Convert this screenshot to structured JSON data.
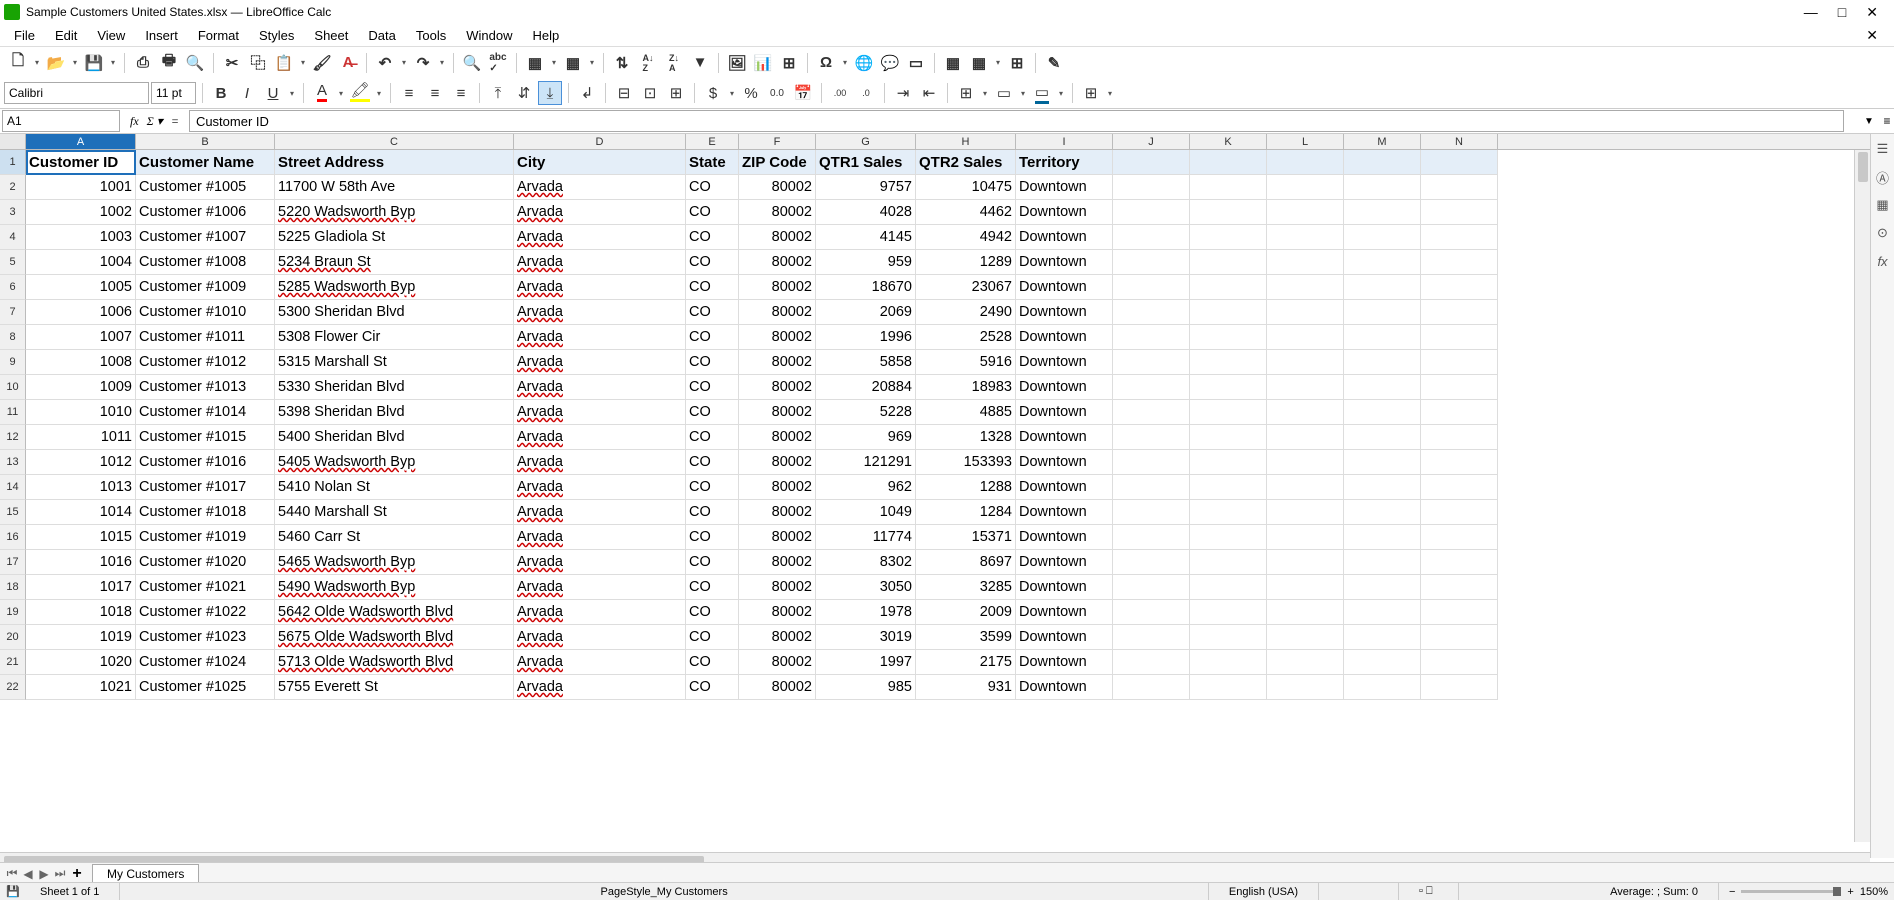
{
  "window": {
    "title": "Sample Customers United States.xlsx — LibreOffice Calc"
  },
  "menu": [
    "File",
    "Edit",
    "View",
    "Insert",
    "Format",
    "Styles",
    "Sheet",
    "Data",
    "Tools",
    "Window",
    "Help"
  ],
  "format": {
    "font_name": "Calibri",
    "font_size": "11 pt"
  },
  "formula": {
    "cell_ref": "A1",
    "content": "Customer ID"
  },
  "columns": [
    "A",
    "B",
    "C",
    "D",
    "E",
    "F",
    "G",
    "H",
    "I",
    "J",
    "K",
    "L",
    "M",
    "N"
  ],
  "headers": [
    "Customer ID",
    "Customer Name",
    "Street Address",
    "City",
    "State",
    "ZIP Code",
    "QTR1 Sales",
    "QTR2 Sales",
    "Territory"
  ],
  "rows": [
    {
      "id": 1001,
      "name": "Customer #1005",
      "street": "11700 W 58th Ave",
      "city": "Arvada",
      "state": "CO",
      "zip": 80002,
      "q1": 9757,
      "q2": 10475,
      "terr": "Downtown"
    },
    {
      "id": 1002,
      "name": "Customer #1006",
      "street": "5220 Wadsworth Byp",
      "city": "Arvada",
      "state": "CO",
      "zip": 80002,
      "q1": 4028,
      "q2": 4462,
      "terr": "Downtown"
    },
    {
      "id": 1003,
      "name": "Customer #1007",
      "street": "5225 Gladiola St",
      "city": "Arvada",
      "state": "CO",
      "zip": 80002,
      "q1": 4145,
      "q2": 4942,
      "terr": "Downtown"
    },
    {
      "id": 1004,
      "name": "Customer #1008",
      "street": "5234 Braun St",
      "city": "Arvada",
      "state": "CO",
      "zip": 80002,
      "q1": 959,
      "q2": 1289,
      "terr": "Downtown"
    },
    {
      "id": 1005,
      "name": "Customer #1009",
      "street": "5285 Wadsworth Byp",
      "city": "Arvada",
      "state": "CO",
      "zip": 80002,
      "q1": 18670,
      "q2": 23067,
      "terr": "Downtown"
    },
    {
      "id": 1006,
      "name": "Customer #1010",
      "street": "5300 Sheridan Blvd",
      "city": "Arvada",
      "state": "CO",
      "zip": 80002,
      "q1": 2069,
      "q2": 2490,
      "terr": "Downtown"
    },
    {
      "id": 1007,
      "name": "Customer #1011",
      "street": "5308 Flower Cir",
      "city": "Arvada",
      "state": "CO",
      "zip": 80002,
      "q1": 1996,
      "q2": 2528,
      "terr": "Downtown"
    },
    {
      "id": 1008,
      "name": "Customer #1012",
      "street": "5315 Marshall St",
      "city": "Arvada",
      "state": "CO",
      "zip": 80002,
      "q1": 5858,
      "q2": 5916,
      "terr": "Downtown"
    },
    {
      "id": 1009,
      "name": "Customer #1013",
      "street": "5330 Sheridan Blvd",
      "city": "Arvada",
      "state": "CO",
      "zip": 80002,
      "q1": 20884,
      "q2": 18983,
      "terr": "Downtown"
    },
    {
      "id": 1010,
      "name": "Customer #1014",
      "street": "5398 Sheridan Blvd",
      "city": "Arvada",
      "state": "CO",
      "zip": 80002,
      "q1": 5228,
      "q2": 4885,
      "terr": "Downtown"
    },
    {
      "id": 1011,
      "name": "Customer #1015",
      "street": "5400 Sheridan Blvd",
      "city": "Arvada",
      "state": "CO",
      "zip": 80002,
      "q1": 969,
      "q2": 1328,
      "terr": "Downtown"
    },
    {
      "id": 1012,
      "name": "Customer #1016",
      "street": "5405 Wadsworth Byp",
      "city": "Arvada",
      "state": "CO",
      "zip": 80002,
      "q1": 121291,
      "q2": 153393,
      "terr": "Downtown"
    },
    {
      "id": 1013,
      "name": "Customer #1017",
      "street": "5410 Nolan St",
      "city": "Arvada",
      "state": "CO",
      "zip": 80002,
      "q1": 962,
      "q2": 1288,
      "terr": "Downtown"
    },
    {
      "id": 1014,
      "name": "Customer #1018",
      "street": "5440 Marshall St",
      "city": "Arvada",
      "state": "CO",
      "zip": 80002,
      "q1": 1049,
      "q2": 1284,
      "terr": "Downtown"
    },
    {
      "id": 1015,
      "name": "Customer #1019",
      "street": "5460 Carr St",
      "city": "Arvada",
      "state": "CO",
      "zip": 80002,
      "q1": 11774,
      "q2": 15371,
      "terr": "Downtown"
    },
    {
      "id": 1016,
      "name": "Customer #1020",
      "street": "5465 Wadsworth Byp",
      "city": "Arvada",
      "state": "CO",
      "zip": 80002,
      "q1": 8302,
      "q2": 8697,
      "terr": "Downtown"
    },
    {
      "id": 1017,
      "name": "Customer #1021",
      "street": "5490 Wadsworth Byp",
      "city": "Arvada",
      "state": "CO",
      "zip": 80002,
      "q1": 3050,
      "q2": 3285,
      "terr": "Downtown"
    },
    {
      "id": 1018,
      "name": "Customer #1022",
      "street": "5642 Olde Wadsworth Blvd",
      "city": "Arvada",
      "state": "CO",
      "zip": 80002,
      "q1": 1978,
      "q2": 2009,
      "terr": "Downtown"
    },
    {
      "id": 1019,
      "name": "Customer #1023",
      "street": "5675 Olde Wadsworth Blvd",
      "city": "Arvada",
      "state": "CO",
      "zip": 80002,
      "q1": 3019,
      "q2": 3599,
      "terr": "Downtown"
    },
    {
      "id": 1020,
      "name": "Customer #1024",
      "street": "5713 Olde Wadsworth Blvd",
      "city": "Arvada",
      "state": "CO",
      "zip": 80002,
      "q1": 1997,
      "q2": 2175,
      "terr": "Downtown"
    },
    {
      "id": 1021,
      "name": "Customer #1025",
      "street": "5755 Everett St",
      "city": "Arvada",
      "state": "CO",
      "zip": 80002,
      "q1": 985,
      "q2": 931,
      "terr": "Downtown"
    }
  ],
  "sheet_tab": "My Customers",
  "status": {
    "sheet": "Sheet 1 of 1",
    "pagestyle": "PageStyle_My Customers",
    "lang": "English (USA)",
    "calc": "Average: ; Sum: 0",
    "zoom": "150%"
  }
}
